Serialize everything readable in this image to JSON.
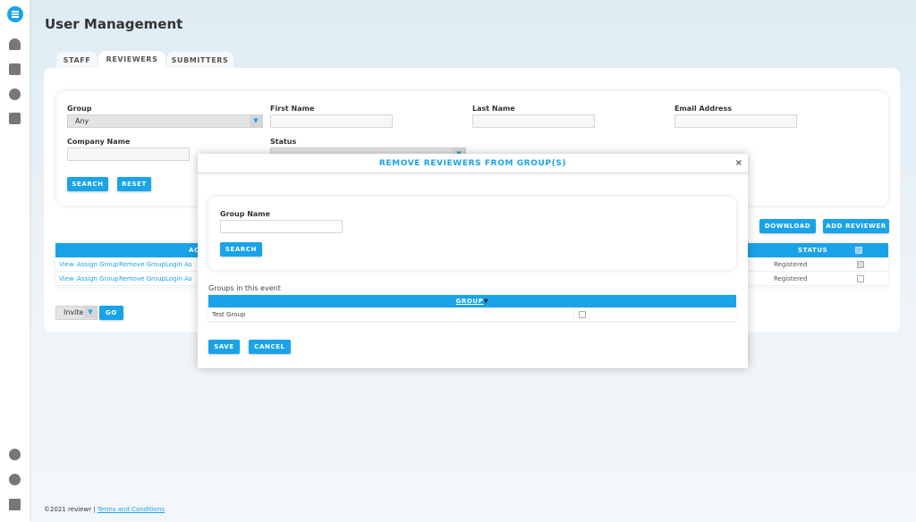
{
  "app": {
    "title": "User Management"
  },
  "sidebar": {
    "items": [
      "dashboard-icon",
      "calendar-icon",
      "gear-icon",
      "clipboard-icon"
    ],
    "bottom": [
      "help-icon",
      "user-icon",
      "logout-icon"
    ]
  },
  "tabs": [
    {
      "label": "STAFF"
    },
    {
      "label": "REVIEWERS",
      "active": true
    },
    {
      "label": "SUBMITTERS"
    }
  ],
  "filters": {
    "group_label": "Group",
    "group_value": "Any",
    "first_name_label": "First Name",
    "last_name_label": "Last Name",
    "email_label": "Email Address",
    "company_label": "Company Name",
    "status_label": "Status",
    "search": "SEARCH",
    "reset": "RESET"
  },
  "toolbar": {
    "download": "DOWNLOAD",
    "add_reviewer": "ADD REVIEWER"
  },
  "table": {
    "actions_header": "AC",
    "status_header": "STATUS",
    "rows": [
      {
        "actions": [
          "View",
          "Assign Group",
          "Remove Group",
          "Login As"
        ],
        "status": "Registered",
        "checked": true
      },
      {
        "actions": [
          "View",
          "Assign Group",
          "Remove Group",
          "Login As"
        ],
        "status": "Registered",
        "checked": false
      }
    ]
  },
  "bulk": {
    "action": "Invite",
    "go": "GO"
  },
  "modal": {
    "title": "REMOVE REVIEWERS FROM GROUP(S)",
    "close": "×",
    "group_name_label": "Group Name",
    "group_name_value": "",
    "search": "SEARCH",
    "groups_label": "Groups in this event",
    "group_header": "GROUP",
    "groups": [
      {
        "name": "Test Group",
        "checked": false
      }
    ],
    "save": "SAVE",
    "cancel": "CANCEL"
  },
  "footer": {
    "copyright": "©2021 reviewr |",
    "terms": "Terms and Conditions"
  },
  "colors": {
    "accent": "#1aa3e8"
  }
}
